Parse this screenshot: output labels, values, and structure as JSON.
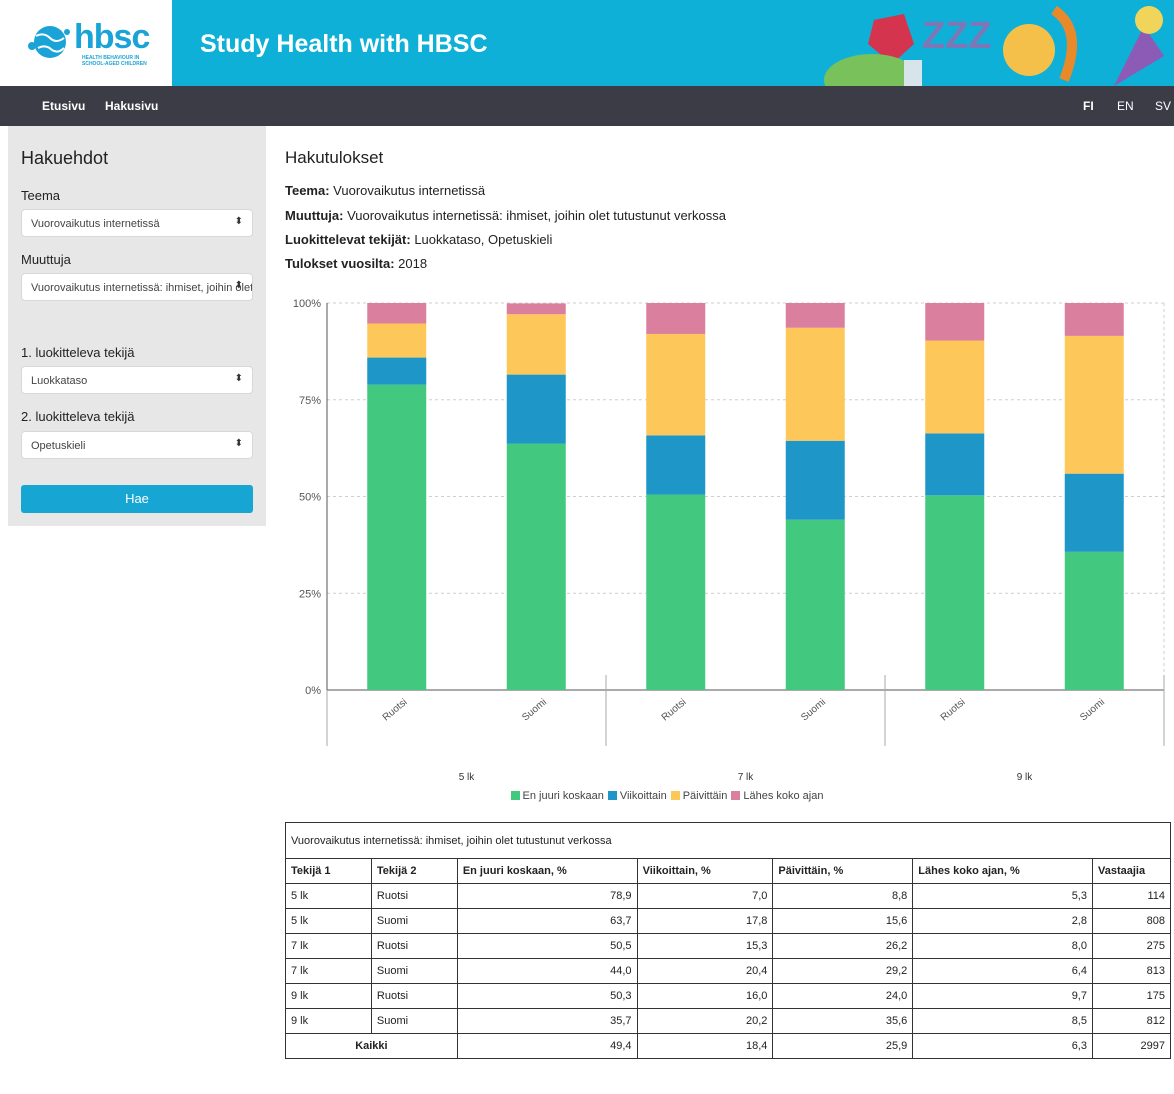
{
  "header": {
    "logo_text": "hbsc",
    "logo_subtitle": "HEALTH BEHAVIOUR IN SCHOOL-AGED CHILDREN",
    "title": "Study Health with HBSC"
  },
  "nav": {
    "home": "Etusivu",
    "search": "Hakusivu",
    "languages": [
      "FI",
      "EN",
      "SV"
    ],
    "active_language": "FI"
  },
  "sidebar": {
    "title": "Hakuehdot",
    "theme_label": "Teema",
    "theme_value": "Vuorovaikutus internetissä",
    "variable_label": "Muuttuja",
    "variable_value": "Vuorovaikutus internetissä: ihmiset, joihin olet tutustunut verkossa",
    "factor1_label": "1. luokitteleva tekijä",
    "factor1_value": "Luokkataso",
    "factor2_label": "2. luokitteleva tekijä",
    "factor2_value": "Opetuskieli",
    "search_button": "Hae"
  },
  "results": {
    "title": "Hakutulokset",
    "theme_key": "Teema:",
    "theme_val": " Vuorovaikutus internetissä",
    "variable_key": "Muuttuja:",
    "variable_val": " Vuorovaikutus internetissä: ihmiset, joihin olet tutustunut verkossa",
    "factors_key": "Luokittelevat tekijät:",
    "factors_val": " Luokkataso, Opetuskieli",
    "years_key": "Tulokset vuosilta:",
    "years_val": " 2018"
  },
  "colors": {
    "series": [
      "#42c97f",
      "#1e96c8",
      "#fec75a",
      "#db7f9f"
    ],
    "banner": "#0fb0d8",
    "nav": "#3c3c46",
    "button": "#17a6d3"
  },
  "chart_data": {
    "type": "bar",
    "stacked": true,
    "groups": [
      "5 lk",
      "7 lk",
      "9 lk"
    ],
    "categories": [
      "Ruotsi",
      "Suomi",
      "Ruotsi",
      "Suomi",
      "Ruotsi",
      "Suomi"
    ],
    "series": [
      {
        "name": "En juuri koskaan",
        "values": [
          78.9,
          63.7,
          50.5,
          44.0,
          50.3,
          35.7
        ]
      },
      {
        "name": "Viikoittain",
        "values": [
          7.0,
          17.8,
          15.3,
          20.4,
          16.0,
          20.2
        ]
      },
      {
        "name": "Päivittäin",
        "values": [
          8.8,
          15.6,
          26.2,
          29.2,
          24.0,
          35.6
        ]
      },
      {
        "name": "Lähes koko ajan",
        "values": [
          5.3,
          2.8,
          8.0,
          6.4,
          9.7,
          8.5
        ]
      }
    ],
    "y_ticks": [
      "0%",
      "25%",
      "50%",
      "75%",
      "100%"
    ],
    "ylim": [
      0,
      100
    ],
    "grid": true,
    "legend_position": "bottom"
  },
  "table": {
    "caption": "Vuorovaikutus internetissä: ihmiset, joihin olet tutustunut verkossa",
    "headers": [
      "Tekijä 1",
      "Tekijä 2",
      "En juuri koskaan, %",
      "Viikoittain, %",
      "Päivittäin, %",
      "Lähes koko ajan, %",
      "Vastaajia"
    ],
    "rows": [
      [
        "5 lk",
        "Ruotsi",
        "78,9",
        "7,0",
        "8,8",
        "5,3",
        "114"
      ],
      [
        "5 lk",
        "Suomi",
        "63,7",
        "17,8",
        "15,6",
        "2,8",
        "808"
      ],
      [
        "7 lk",
        "Ruotsi",
        "50,5",
        "15,3",
        "26,2",
        "8,0",
        "275"
      ],
      [
        "7 lk",
        "Suomi",
        "44,0",
        "20,4",
        "29,2",
        "6,4",
        "813"
      ],
      [
        "9 lk",
        "Ruotsi",
        "50,3",
        "16,0",
        "24,0",
        "9,7",
        "175"
      ],
      [
        "9 lk",
        "Suomi",
        "35,7",
        "20,2",
        "35,6",
        "8,5",
        "812"
      ]
    ],
    "total": [
      "Kaikki",
      "49,4",
      "18,4",
      "25,9",
      "6,3",
      "2997"
    ]
  }
}
